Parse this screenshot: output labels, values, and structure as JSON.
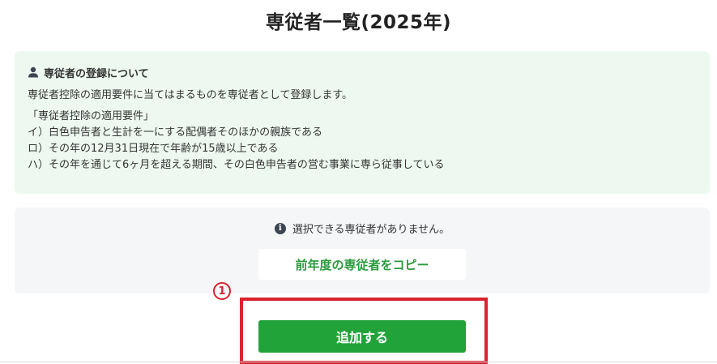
{
  "page": {
    "title": "専従者一覧(2025年)"
  },
  "info": {
    "icon": "person-icon",
    "heading": "専従者の登録について",
    "intro": "専従者控除の適用要件に当てはまるものを専従者として登録します。",
    "requirements_title": "「専従者控除の適用要件」",
    "requirements": [
      "イ）白色申告者と生計を一にする配偶者そのほかの親族である",
      "ロ）その年の12月31日現在で年齢が15歳以上である",
      "ハ）その年を通じて6ヶ月を超える期間、その白色申告者の営む事業に専ら従事している"
    ]
  },
  "selection": {
    "icon": "info-icon",
    "notice": "選択できる専従者がありません。",
    "copy_button": "前年度の専従者をコピー"
  },
  "annotation": {
    "step_marker": "1"
  },
  "actions": {
    "add_button": "追加する"
  },
  "colors": {
    "info_background": "#edf9f0",
    "selection_background": "#f5f6f8",
    "primary_green": "#22a33a",
    "copy_text_green": "#2a9a3c",
    "highlight_red": "#d9232d"
  }
}
